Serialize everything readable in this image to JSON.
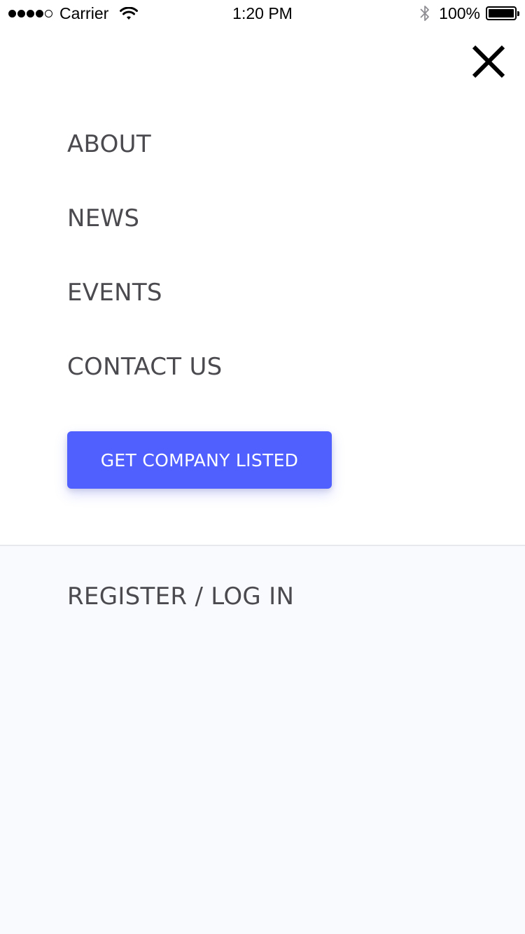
{
  "status_bar": {
    "carrier": "Carrier",
    "time": "1:20 PM",
    "battery": "100%",
    "signal_bars_filled": 4,
    "signal_bars_total": 5,
    "battery_level": 1.0,
    "icons": [
      "signal-icon",
      "wifi-icon",
      "bluetooth-icon",
      "battery-icon"
    ]
  },
  "header": {
    "close_icon": "close-icon"
  },
  "menu": {
    "items": [
      {
        "label": "ABOUT"
      },
      {
        "label": "NEWS"
      },
      {
        "label": "EVENTS"
      },
      {
        "label": "CONTACT US"
      }
    ]
  },
  "cta": {
    "label": "GET COMPANY LISTED",
    "color": "#5060ff"
  },
  "footer": {
    "auth_label": "REGISTER / LOG IN",
    "background": "#f9fafe"
  },
  "colors": {
    "text": "#4a4a4f",
    "accent": "#5060ff"
  }
}
